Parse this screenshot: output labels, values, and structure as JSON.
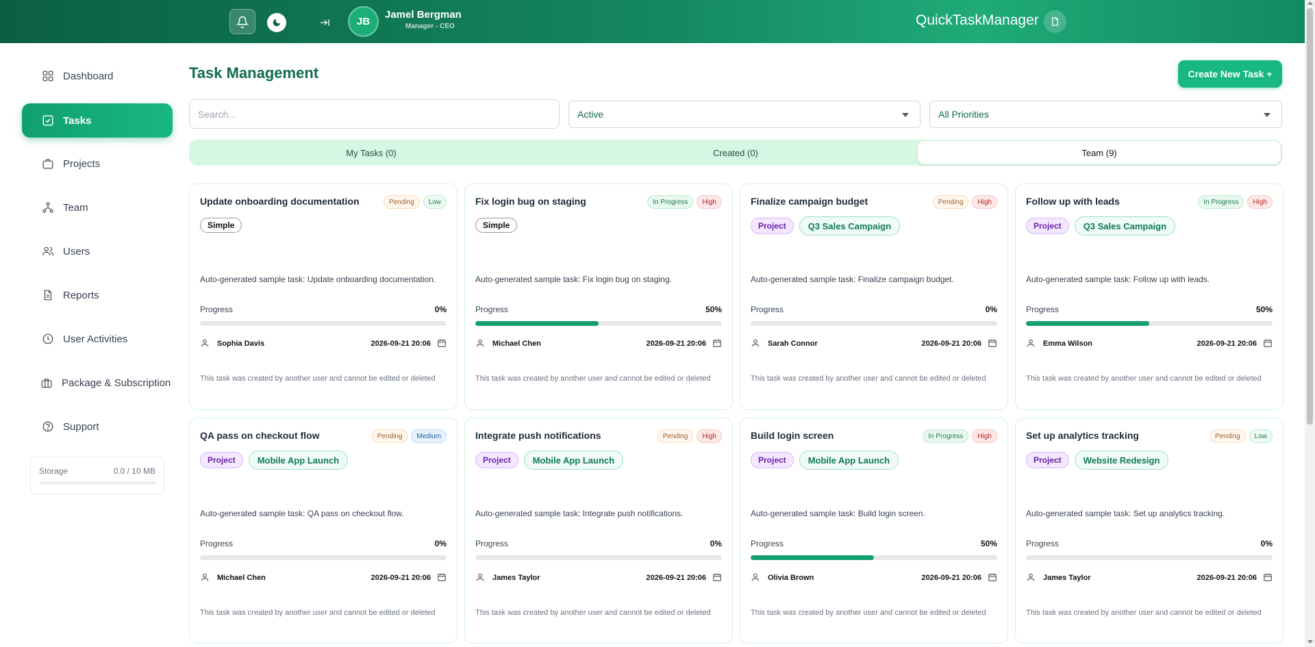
{
  "header": {
    "user_initials": "JB",
    "user_name": "Jamel Bergman",
    "user_role": "Manager - CEO",
    "brand": "QuickTaskManager"
  },
  "sidebar": {
    "items": [
      {
        "label": "Dashboard",
        "icon": "grid-icon"
      },
      {
        "label": "Tasks",
        "icon": "check-square-icon"
      },
      {
        "label": "Projects",
        "icon": "briefcase-icon"
      },
      {
        "label": "Team",
        "icon": "team-icon"
      },
      {
        "label": "Users",
        "icon": "users-icon"
      },
      {
        "label": "Reports",
        "icon": "document-icon"
      },
      {
        "label": "User Activities",
        "icon": "clock-icon"
      },
      {
        "label": "Package & Subscription",
        "icon": "package-icon"
      },
      {
        "label": "Support",
        "icon": "help-icon"
      }
    ],
    "storage_label": "Storage",
    "storage_value": "0.0 / 10 MB",
    "storage_fraction": 0
  },
  "main": {
    "title": "Task Management",
    "create_label": "Create New Task +",
    "search_placeholder": "Search...",
    "status_filter": "Active",
    "priority_filter": "All Priorities",
    "tabs": [
      {
        "label": "My Tasks (0)"
      },
      {
        "label": "Created (0)"
      },
      {
        "label": "Team (9)"
      }
    ]
  },
  "cards": [
    {
      "title": "Update onboarding documentation",
      "status": "Pending",
      "priority": "Low",
      "type": "Simple",
      "project": "",
      "desc": "Auto-generated sample task: Update onboarding documentation.",
      "progress_label": "Progress",
      "progress": "0%",
      "assignee": "Sophia Davis",
      "date": "2026-09-21 20:06",
      "note": "This task was created by another user and cannot be edited or deleted"
    },
    {
      "title": "Fix login bug on staging",
      "status": "In Progress",
      "priority": "High",
      "type": "Simple",
      "project": "",
      "desc": "Auto-generated sample task: Fix login bug on staging.",
      "progress_label": "Progress",
      "progress": "50%",
      "assignee": "Michael Chen",
      "date": "2026-09-21 20:06",
      "note": "This task was created by another user and cannot be edited or deleted"
    },
    {
      "title": "Finalize campaign budget",
      "status": "Pending",
      "priority": "High",
      "type": "Project",
      "project": "Q3 Sales Campaign",
      "desc": "Auto-generated sample task: Finalize campaign budget.",
      "progress_label": "Progress",
      "progress": "0%",
      "assignee": "Sarah Connor",
      "date": "2026-09-21 20:06",
      "note": "This task was created by another user and cannot be edited or deleted"
    },
    {
      "title": "Follow up with leads",
      "status": "In Progress",
      "priority": "High",
      "type": "Project",
      "project": "Q3 Sales Campaign",
      "desc": "Auto-generated sample task: Follow up with leads.",
      "progress_label": "Progress",
      "progress": "50%",
      "assignee": "Emma Wilson",
      "date": "2026-09-21 20:06",
      "note": "This task was created by another user and cannot be edited or deleted"
    },
    {
      "title": "QA pass on checkout flow",
      "status": "Pending",
      "priority": "Medium",
      "type": "Project",
      "project": "Mobile App Launch",
      "desc": "Auto-generated sample task: QA pass on checkout flow.",
      "progress_label": "Progress",
      "progress": "0%",
      "assignee": "Michael Chen",
      "date": "2026-09-21 20:06",
      "note": "This task was created by another user and cannot be edited or deleted"
    },
    {
      "title": "Integrate push notifications",
      "status": "Pending",
      "priority": "High",
      "type": "Project",
      "project": "Mobile App Launch",
      "desc": "Auto-generated sample task: Integrate push notifications.",
      "progress_label": "Progress",
      "progress": "0%",
      "assignee": "James Taylor",
      "date": "2026-09-21 20:06",
      "note": "This task was created by another user and cannot be edited or deleted"
    },
    {
      "title": "Build login screen",
      "status": "In Progress",
      "priority": "High",
      "type": "Project",
      "project": "Mobile App Launch",
      "desc": "Auto-generated sample task: Build login screen.",
      "progress_label": "Progress",
      "progress": "50%",
      "assignee": "Olivia Brown",
      "date": "2026-09-21 20:06",
      "note": "This task was created by another user and cannot be edited or deleted"
    },
    {
      "title": "Set up analytics tracking",
      "status": "Pending",
      "priority": "Low",
      "type": "Project",
      "project": "Website Redesign",
      "desc": "Auto-generated sample task: Set up analytics tracking.",
      "progress_label": "Progress",
      "progress": "0%",
      "assignee": "James Taylor",
      "date": "2026-09-21 20:06",
      "note": "This task was created by another user and cannot be edited or deleted"
    }
  ],
  "colors": {
    "brand": "#0f6b4b",
    "accent": "#18b880"
  }
}
